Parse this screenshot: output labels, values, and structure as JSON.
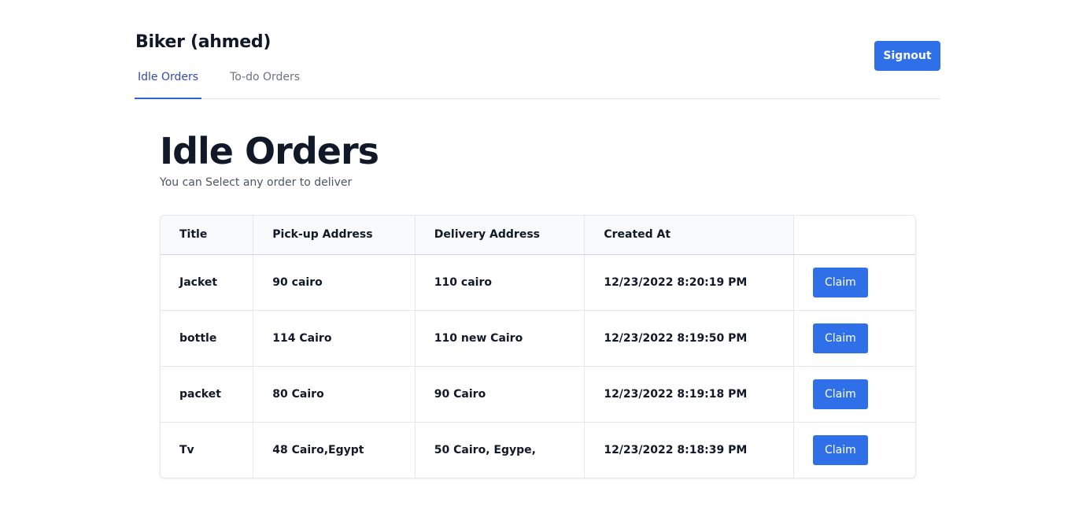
{
  "header": {
    "title": "Biker (ahmed)",
    "tabs": [
      {
        "label": "Idle Orders",
        "active": true
      },
      {
        "label": "To-do Orders",
        "active": false
      }
    ],
    "signout_label": "Signout"
  },
  "main": {
    "title": "Idle Orders",
    "subtitle": "You can Select any order to deliver"
  },
  "table": {
    "columns": [
      "Title",
      "Pick-up Address",
      "Delivery Address",
      "Created At",
      ""
    ],
    "rows": [
      {
        "title": "Jacket",
        "pickup": "90 cairo",
        "delivery": "110 cairo",
        "created": "12/23/2022 8:20:19 PM",
        "action": "Claim"
      },
      {
        "title": "bottle",
        "pickup": "114 Cairo",
        "delivery": "110 new Cairo",
        "created": "12/23/2022 8:19:50 PM",
        "action": "Claim"
      },
      {
        "title": "packet",
        "pickup": "80 Cairo",
        "delivery": "90 Cairo",
        "created": "12/23/2022 8:19:18 PM",
        "action": "Claim"
      },
      {
        "title": "Tv",
        "pickup": "48 Cairo,Egypt",
        "delivery": "50 Cairo, Egype,",
        "created": "12/23/2022 8:18:39 PM",
        "action": "Claim"
      }
    ]
  },
  "colors": {
    "primary": "#2f6fe8",
    "active_tab_text": "#3349a8",
    "active_tab_underline": "#2f66d8",
    "border": "#e5e7eb",
    "header_bg": "#f9fafb"
  }
}
